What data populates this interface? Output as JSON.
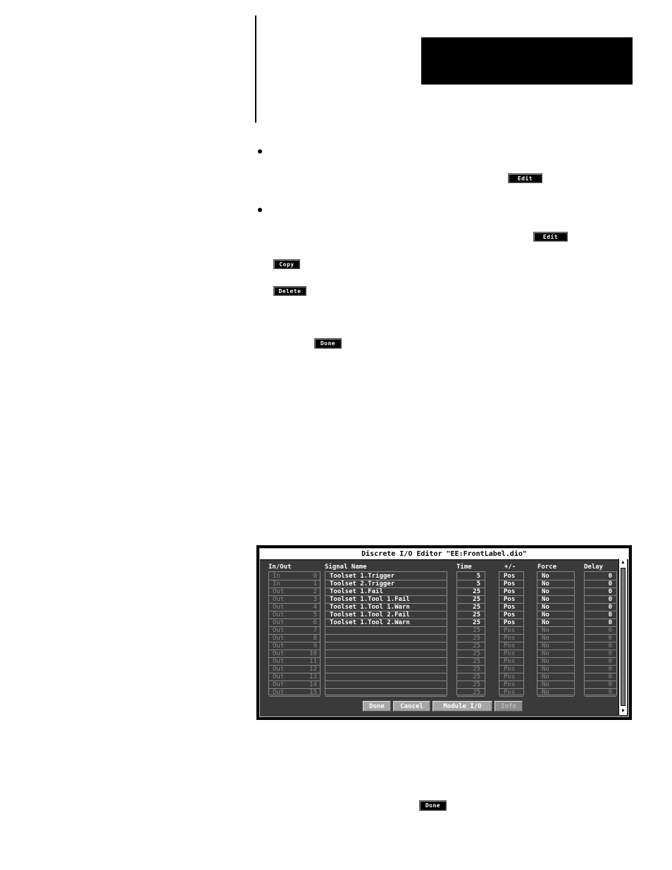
{
  "page": {
    "inline_buttons": {
      "edit_1": "Edit",
      "edit_2": "Edit",
      "copy": "Copy",
      "delete": "Delete",
      "done_1": "Done",
      "done_2": "Done"
    }
  },
  "dialog": {
    "title": "Discrete I/O Editor \"EE:FrontLabel.dio\"",
    "columns": {
      "inout": "In/Out",
      "signal": "Signal Name",
      "time": "Time",
      "polarity": "+/-",
      "force": "Force",
      "delay": "Delay"
    },
    "rows": [
      {
        "dir": "In",
        "num": "0",
        "signal": "Toolset 1.Trigger",
        "time": "5",
        "pol": "Pos",
        "force": "No",
        "delay": "0",
        "active": true,
        "dir_active": false
      },
      {
        "dir": "In",
        "num": "1",
        "signal": "Toolset 2.Trigger",
        "time": "5",
        "pol": "Pos",
        "force": "No",
        "delay": "0",
        "active": true,
        "dir_active": false
      },
      {
        "dir": "Out",
        "num": "2",
        "signal": "Toolset 1.Fail",
        "time": "25",
        "pol": "Pos",
        "force": "No",
        "delay": "0",
        "active": true,
        "dir_active": false
      },
      {
        "dir": "Out",
        "num": "3",
        "signal": "Toolset 1.Tool 1.Fail",
        "time": "25",
        "pol": "Pos",
        "force": "No",
        "delay": "0",
        "active": true,
        "dir_active": false
      },
      {
        "dir": "Out",
        "num": "4",
        "signal": "Toolset 1.Tool 1.Warn",
        "time": "25",
        "pol": "Pos",
        "force": "No",
        "delay": "0",
        "active": true,
        "dir_active": false
      },
      {
        "dir": "Out",
        "num": "5",
        "signal": "Toolset 1.Tool 2.Fail",
        "time": "25",
        "pol": "Pos",
        "force": "No",
        "delay": "0",
        "active": true,
        "dir_active": false
      },
      {
        "dir": "Out",
        "num": "6",
        "signal": "Toolset 1.Tool 2.Warn",
        "time": "25",
        "pol": "Pos",
        "force": "No",
        "delay": "0",
        "active": true,
        "dir_active": false
      },
      {
        "dir": "Out",
        "num": "7",
        "signal": "",
        "time": "25",
        "pol": "Pos",
        "force": "No",
        "delay": "0",
        "active": false,
        "dir_active": false
      },
      {
        "dir": "Out",
        "num": "8",
        "signal": "",
        "time": "25",
        "pol": "Pos",
        "force": "No",
        "delay": "0",
        "active": false,
        "dir_active": false
      },
      {
        "dir": "Out",
        "num": "9",
        "signal": "",
        "time": "25",
        "pol": "Pos",
        "force": "No",
        "delay": "0",
        "active": false,
        "dir_active": false
      },
      {
        "dir": "Out",
        "num": "10",
        "signal": "",
        "time": "25",
        "pol": "Pos",
        "force": "No",
        "delay": "0",
        "active": false,
        "dir_active": false
      },
      {
        "dir": "Out",
        "num": "11",
        "signal": "",
        "time": "25",
        "pol": "Pos",
        "force": "No",
        "delay": "0",
        "active": false,
        "dir_active": false
      },
      {
        "dir": "Out",
        "num": "12",
        "signal": "",
        "time": "25",
        "pol": "Pos",
        "force": "No",
        "delay": "0",
        "active": false,
        "dir_active": false
      },
      {
        "dir": "Out",
        "num": "13",
        "signal": "",
        "time": "25",
        "pol": "Pos",
        "force": "No",
        "delay": "0",
        "active": false,
        "dir_active": false
      },
      {
        "dir": "Out",
        "num": "14",
        "signal": "",
        "time": "25",
        "pol": "Pos",
        "force": "No",
        "delay": "0",
        "active": false,
        "dir_active": false
      },
      {
        "dir": "Out",
        "num": "15",
        "signal": "",
        "time": "25",
        "pol": "Pos",
        "force": "No",
        "delay": "0",
        "active": false,
        "dir_active": false
      }
    ],
    "buttons": {
      "done": "Done",
      "cancel": "Cancel",
      "module_io": "Module I/O",
      "info": "Info"
    }
  }
}
